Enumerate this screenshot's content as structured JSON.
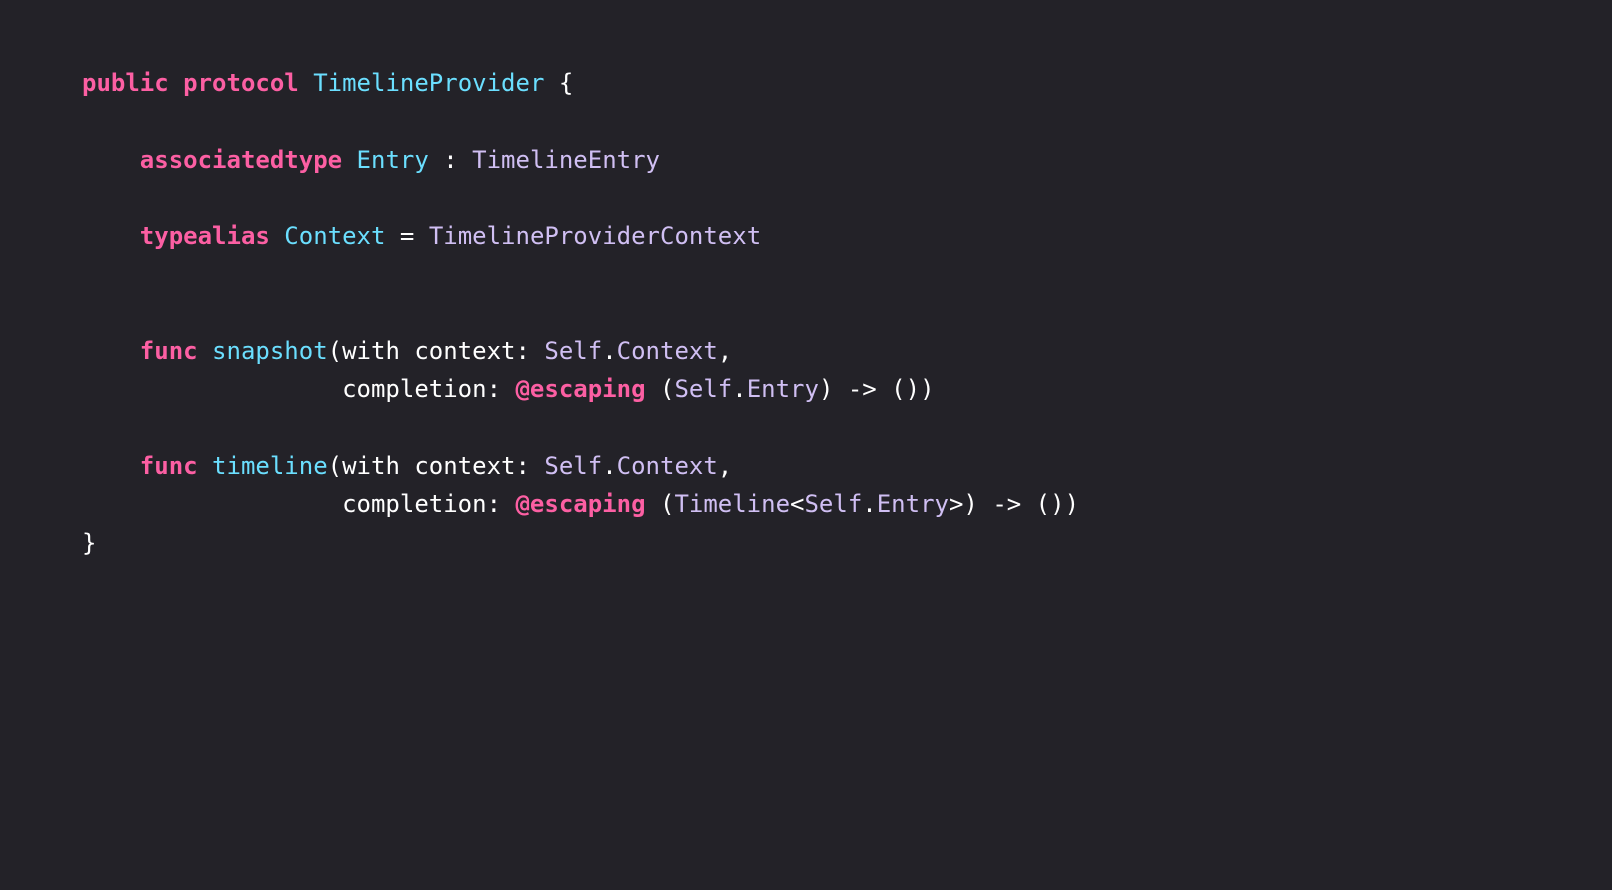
{
  "code": {
    "language": "Swift",
    "colors": {
      "background": "#232228",
      "keyword": "#fc5fa3",
      "declaration": "#6bdfff",
      "type": "#d0bff3",
      "plain": "#ffffff"
    },
    "lines": [
      {
        "tokens": [
          {
            "text": "public protocol",
            "kind": "keyword"
          },
          {
            "text": " ",
            "kind": "plain"
          },
          {
            "text": "TimelineProvider",
            "kind": "decl"
          },
          {
            "text": " {",
            "kind": "plain"
          }
        ]
      },
      {
        "tokens": []
      },
      {
        "tokens": [
          {
            "text": "    ",
            "kind": "plain"
          },
          {
            "text": "associatedtype",
            "kind": "keyword"
          },
          {
            "text": " ",
            "kind": "plain"
          },
          {
            "text": "Entry",
            "kind": "decl"
          },
          {
            "text": " : ",
            "kind": "plain"
          },
          {
            "text": "TimelineEntry",
            "kind": "type"
          }
        ]
      },
      {
        "tokens": []
      },
      {
        "tokens": [
          {
            "text": "    ",
            "kind": "plain"
          },
          {
            "text": "typealias",
            "kind": "keyword"
          },
          {
            "text": " ",
            "kind": "plain"
          },
          {
            "text": "Context",
            "kind": "decl"
          },
          {
            "text": " = ",
            "kind": "plain"
          },
          {
            "text": "TimelineProviderContext",
            "kind": "type"
          }
        ]
      },
      {
        "tokens": []
      },
      {
        "tokens": []
      },
      {
        "tokens": [
          {
            "text": "    ",
            "kind": "plain"
          },
          {
            "text": "func",
            "kind": "keyword"
          },
          {
            "text": " ",
            "kind": "plain"
          },
          {
            "text": "snapshot",
            "kind": "decl"
          },
          {
            "text": "(with context: ",
            "kind": "plain"
          },
          {
            "text": "Self",
            "kind": "type"
          },
          {
            "text": ".",
            "kind": "plain"
          },
          {
            "text": "Context",
            "kind": "type"
          },
          {
            "text": ",",
            "kind": "plain"
          }
        ]
      },
      {
        "tokens": [
          {
            "text": "                  completion: ",
            "kind": "plain"
          },
          {
            "text": "@escaping",
            "kind": "keyword"
          },
          {
            "text": " (",
            "kind": "plain"
          },
          {
            "text": "Self",
            "kind": "type"
          },
          {
            "text": ".",
            "kind": "plain"
          },
          {
            "text": "Entry",
            "kind": "type"
          },
          {
            "text": ") -> ())",
            "kind": "plain"
          }
        ]
      },
      {
        "tokens": []
      },
      {
        "tokens": [
          {
            "text": "    ",
            "kind": "plain"
          },
          {
            "text": "func",
            "kind": "keyword"
          },
          {
            "text": " ",
            "kind": "plain"
          },
          {
            "text": "timeline",
            "kind": "decl"
          },
          {
            "text": "(with context: ",
            "kind": "plain"
          },
          {
            "text": "Self",
            "kind": "type"
          },
          {
            "text": ".",
            "kind": "plain"
          },
          {
            "text": "Context",
            "kind": "type"
          },
          {
            "text": ",",
            "kind": "plain"
          }
        ]
      },
      {
        "tokens": [
          {
            "text": "                  completion: ",
            "kind": "plain"
          },
          {
            "text": "@escaping",
            "kind": "keyword"
          },
          {
            "text": " (",
            "kind": "plain"
          },
          {
            "text": "Timeline",
            "kind": "type"
          },
          {
            "text": "<",
            "kind": "plain"
          },
          {
            "text": "Self",
            "kind": "type"
          },
          {
            "text": ".",
            "kind": "plain"
          },
          {
            "text": "Entry",
            "kind": "type"
          },
          {
            "text": ">) -> ())",
            "kind": "plain"
          }
        ]
      },
      {
        "tokens": [
          {
            "text": "}",
            "kind": "plain"
          }
        ]
      }
    ]
  }
}
